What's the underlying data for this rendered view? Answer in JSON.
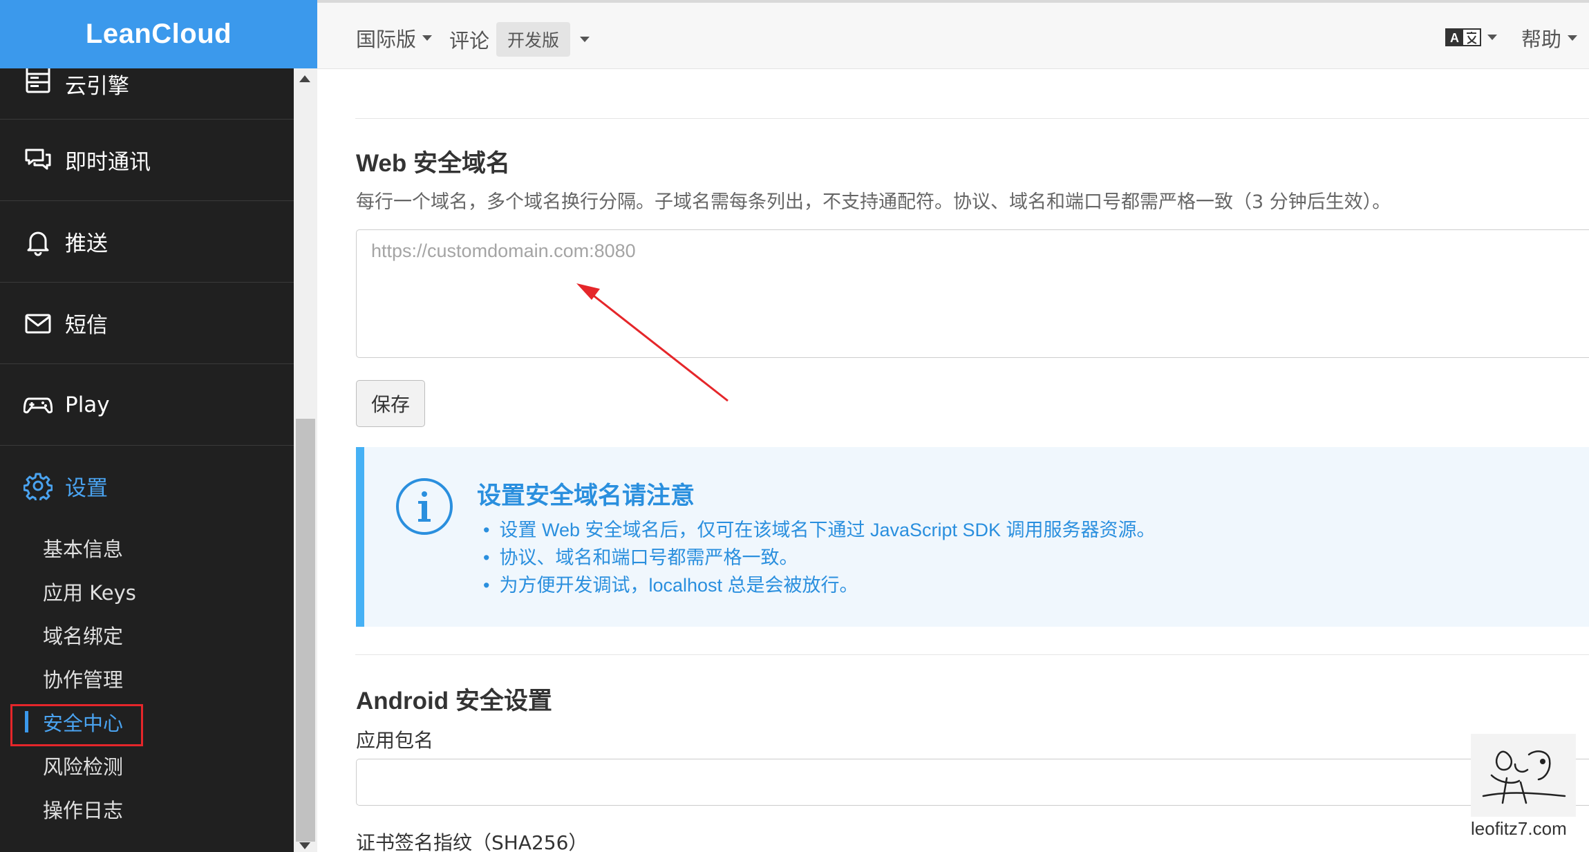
{
  "brand": {
    "logo": "LeanCloud"
  },
  "sidebar": {
    "items": [
      {
        "label": "云引擎",
        "icon": "server-icon"
      },
      {
        "label": "即时通讯",
        "icon": "chat-icon"
      },
      {
        "label": "推送",
        "icon": "bell-icon"
      },
      {
        "label": "短信",
        "icon": "envelope-icon"
      },
      {
        "label": "Play",
        "icon": "gamepad-icon"
      },
      {
        "label": "设置",
        "icon": "gear-icon"
      }
    ],
    "settings_sub": [
      "基本信息",
      "应用 Keys",
      "域名绑定",
      "协作管理",
      "安全中心",
      "风险检测",
      "操作日志"
    ],
    "selected_sub": "安全中心"
  },
  "topbar": {
    "region": "国际版",
    "app_name": "评论",
    "env": "开发版",
    "help": "帮助",
    "lang_icon": "translate-icon"
  },
  "web_domain": {
    "title": "Web 安全域名",
    "description": "每行一个域名，多个域名换行分隔。子域名需每条列出，不支持通配符。协议、域名和端口号都需严格一致（3 分钟后生效）。",
    "placeholder": "https://customdomain.com:8080",
    "save_label": "保存"
  },
  "notice": {
    "title": "设置安全域名请注意",
    "items": [
      "设置 Web 安全域名后，仅可在该域名下通过 JavaScript SDK 调用服务器资源。",
      "协议、域名和端口号都需严格一致。",
      "为方便开发调试，localhost 总是会被放行。"
    ]
  },
  "android": {
    "title": "Android 安全设置",
    "package_label": "应用包名",
    "cert_label": "证书签名指纹（SHA256）"
  },
  "watermark": {
    "text": "leofitz7.com"
  },
  "colors": {
    "brand": "#3b99ec",
    "sidebar_bg": "#202020",
    "accent": "#4aa3f0",
    "notice_bar": "#46b1f5",
    "annotation": "#e5262a"
  }
}
